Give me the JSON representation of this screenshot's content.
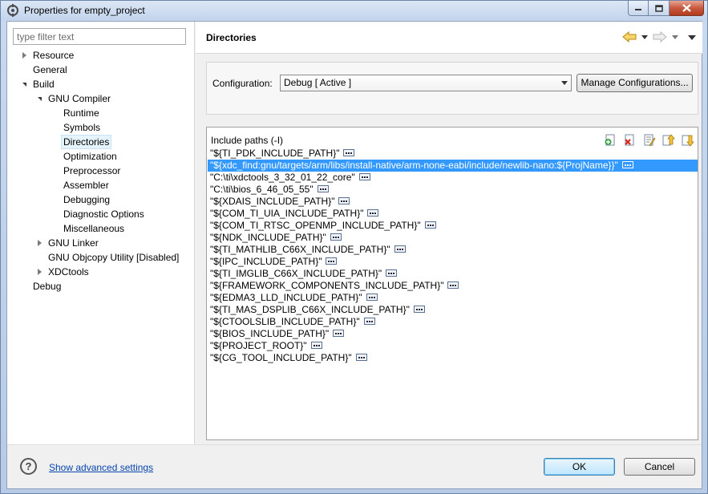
{
  "window": {
    "title": "Properties for empty_project"
  },
  "filter": {
    "placeholder": "type filter text"
  },
  "tree": [
    {
      "label": "Resource",
      "level": 0,
      "state": "collapsed"
    },
    {
      "label": "General",
      "level": 0,
      "state": "leaf"
    },
    {
      "label": "Build",
      "level": 0,
      "state": "expanded"
    },
    {
      "label": "GNU Compiler",
      "level": 1,
      "state": "expanded"
    },
    {
      "label": "Runtime",
      "level": 2,
      "state": "leaf"
    },
    {
      "label": "Symbols",
      "level": 2,
      "state": "leaf"
    },
    {
      "label": "Directories",
      "level": 2,
      "state": "leaf",
      "selected": true
    },
    {
      "label": "Optimization",
      "level": 2,
      "state": "leaf"
    },
    {
      "label": "Preprocessor",
      "level": 2,
      "state": "leaf"
    },
    {
      "label": "Assembler",
      "level": 2,
      "state": "leaf"
    },
    {
      "label": "Debugging",
      "level": 2,
      "state": "leaf"
    },
    {
      "label": "Diagnostic Options",
      "level": 2,
      "state": "leaf"
    },
    {
      "label": "Miscellaneous",
      "level": 2,
      "state": "leaf"
    },
    {
      "label": "GNU Linker",
      "level": 1,
      "state": "collapsed"
    },
    {
      "label": "GNU Objcopy Utility  [Disabled]",
      "level": 1,
      "state": "leaf"
    },
    {
      "label": "XDCtools",
      "level": 1,
      "state": "collapsed"
    },
    {
      "label": "Debug",
      "level": 0,
      "state": "leaf"
    }
  ],
  "page": {
    "title": "Directories",
    "configuration_label": "Configuration:",
    "configuration_value": "Debug  [ Active ]",
    "manage_button": "Manage Configurations..."
  },
  "include_paths": {
    "title": "Include paths (-I)",
    "items": [
      "\"${TI_PDK_INCLUDE_PATH}\"",
      "\"${xdc_find:gnu/targets/arm/libs/install-native/arm-none-eabi/include/newlib-nano:${ProjName}}\"",
      "\"C:\\ti\\xdctools_3_32_01_22_core\"",
      "\"C:\\ti\\bios_6_46_05_55\"",
      "\"${XDAIS_INCLUDE_PATH}\"",
      "\"${COM_TI_UIA_INCLUDE_PATH}\"",
      "\"${COM_TI_RTSC_OPENMP_INCLUDE_PATH}\"",
      "\"${NDK_INCLUDE_PATH}\"",
      "\"${TI_MATHLIB_C66X_INCLUDE_PATH}\"",
      "\"${IPC_INCLUDE_PATH}\"",
      "\"${TI_IMGLIB_C66X_INCLUDE_PATH}\"",
      "\"${FRAMEWORK_COMPONENTS_INCLUDE_PATH}\"",
      "\"${EDMA3_LLD_INCLUDE_PATH}\"",
      "\"${TI_MAS_DSPLIB_C66X_INCLUDE_PATH}\"",
      "\"${CTOOLSLIB_INCLUDE_PATH}\"",
      "\"${BIOS_INCLUDE_PATH}\"",
      "\"${PROJECT_ROOT}\"",
      "\"${CG_TOOL_INCLUDE_PATH}\""
    ],
    "selected_index": 1,
    "tools": [
      "add-icon",
      "delete-icon",
      "edit-icon",
      "move-up-icon",
      "move-down-icon"
    ]
  },
  "footer": {
    "advanced_link": "Show advanced settings",
    "ok_button": "OK",
    "cancel_button": "Cancel",
    "help_glyph": "?"
  },
  "colors": {
    "selection": "#3399ff",
    "link": "#0645ad"
  }
}
